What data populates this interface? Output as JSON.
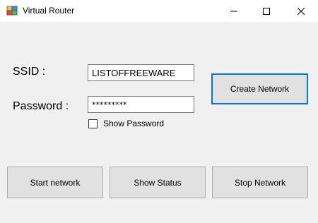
{
  "window": {
    "title": "Virtual Router",
    "icon": "router-app-icon"
  },
  "form": {
    "ssid_label": "SSID :",
    "ssid_value": "LISTOFFREEWARE",
    "password_label": "Password :",
    "password_value": "*********",
    "show_password_label": "Show Password",
    "show_password_checked": false
  },
  "buttons": {
    "create_network": "Create Network",
    "start_network": "Start network",
    "show_status": "Show Status",
    "stop_network": "Stop Network"
  },
  "colors": {
    "focus_border": "#0078d7",
    "button_face": "#e1e1e1",
    "window_bg": "#f0f0f0"
  }
}
